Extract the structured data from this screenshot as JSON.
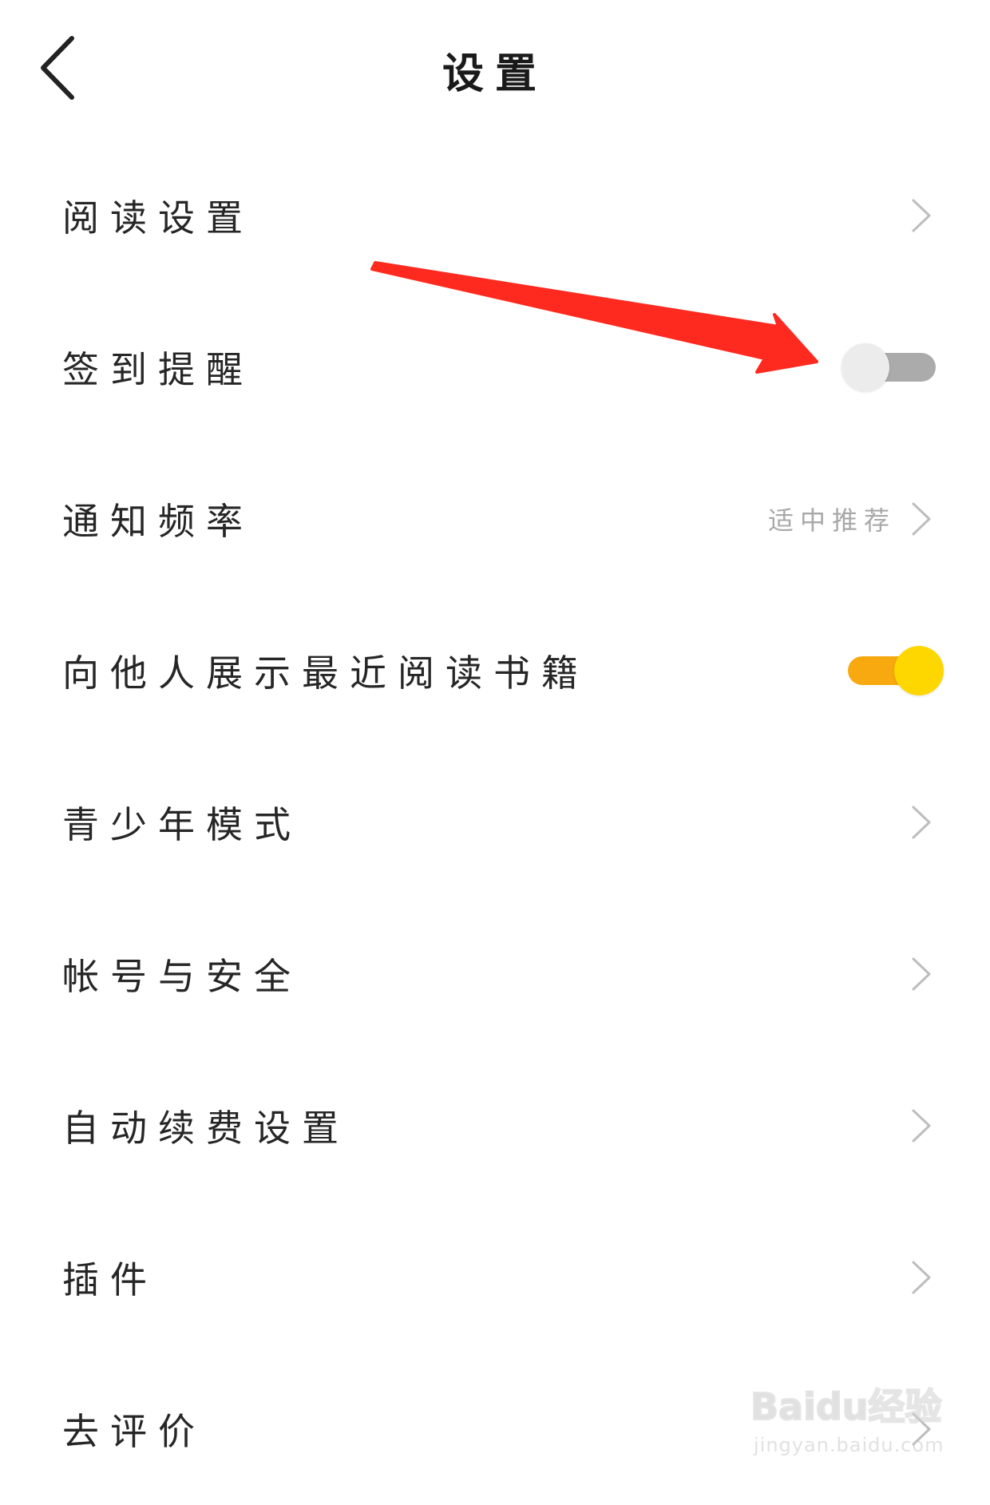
{
  "header": {
    "title": "设置",
    "back_icon": "chevron-left-icon"
  },
  "settings": [
    {
      "id": "reading",
      "label": "阅读设置",
      "control": "chevron"
    },
    {
      "id": "checkin",
      "label": "签到提醒",
      "control": "toggle",
      "checked": false
    },
    {
      "id": "notify",
      "label": "通知频率",
      "control": "chevron",
      "value": "适中推荐"
    },
    {
      "id": "showbooks",
      "label": "向他人展示最近阅读书籍",
      "control": "toggle",
      "checked": true
    },
    {
      "id": "teen",
      "label": "青少年模式",
      "control": "chevron"
    },
    {
      "id": "account",
      "label": "帐号与安全",
      "control": "chevron"
    },
    {
      "id": "autorenew",
      "label": "自动续费设置",
      "control": "chevron"
    },
    {
      "id": "plugins",
      "label": "插件",
      "control": "chevron"
    },
    {
      "id": "rate",
      "label": "去评价",
      "control": "chevron"
    }
  ],
  "colors": {
    "toggle_on_track": "#f8a90f",
    "toggle_on_knob": "#ffd700",
    "toggle_off_track": "#ababab",
    "toggle_off_knob": "#ececec",
    "annotation_arrow": "#ff2a1f"
  },
  "watermark": {
    "brand": "Baidu经验",
    "url": "jingyan.baidu.com"
  }
}
